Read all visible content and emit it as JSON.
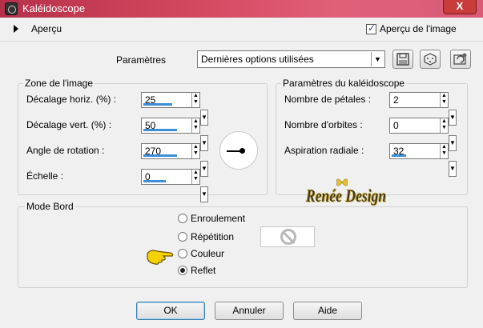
{
  "window": {
    "title": "Kaléidoscope",
    "close_glyph": "X"
  },
  "preview": {
    "label": "Aperçu",
    "checkbox_label": "Aperçu de l'image",
    "checked": true
  },
  "presets": {
    "label": "Paramètres",
    "selected": "Dernières options utilisées",
    "buttons": [
      "save-preset-icon",
      "randomize-icon",
      "reset-icon"
    ]
  },
  "image_zone": {
    "title": "Zone de l'image",
    "fields": [
      {
        "label": "Décalage horiz. (%) :",
        "value": "25",
        "fill": 0.65
      },
      {
        "label": "Décalage vert. (%) :",
        "value": "50",
        "fill": 0.75
      },
      {
        "label": "Angle de rotation :",
        "value": "270",
        "fill": 0.75
      },
      {
        "label": "Échelle :",
        "value": "0",
        "fill": 0.5
      }
    ]
  },
  "kaleido": {
    "title": "Paramètres du kaléidoscope",
    "fields": [
      {
        "label": "Nombre de pétales :",
        "value": "2",
        "fill": 0.0
      },
      {
        "label": "Nombre d'orbites :",
        "value": "0",
        "fill": 0.0
      },
      {
        "label": "Aspiration radiale :",
        "value": "32",
        "fill": 0.32
      }
    ]
  },
  "mode_bord": {
    "title": "Mode Bord",
    "options": [
      "Enroulement",
      "Répétition",
      "Couleur",
      "Reflet"
    ],
    "selected": "Reflet"
  },
  "watermark": "Renée Design",
  "buttons": {
    "ok": "OK",
    "cancel": "Annuler",
    "help": "Aide"
  }
}
